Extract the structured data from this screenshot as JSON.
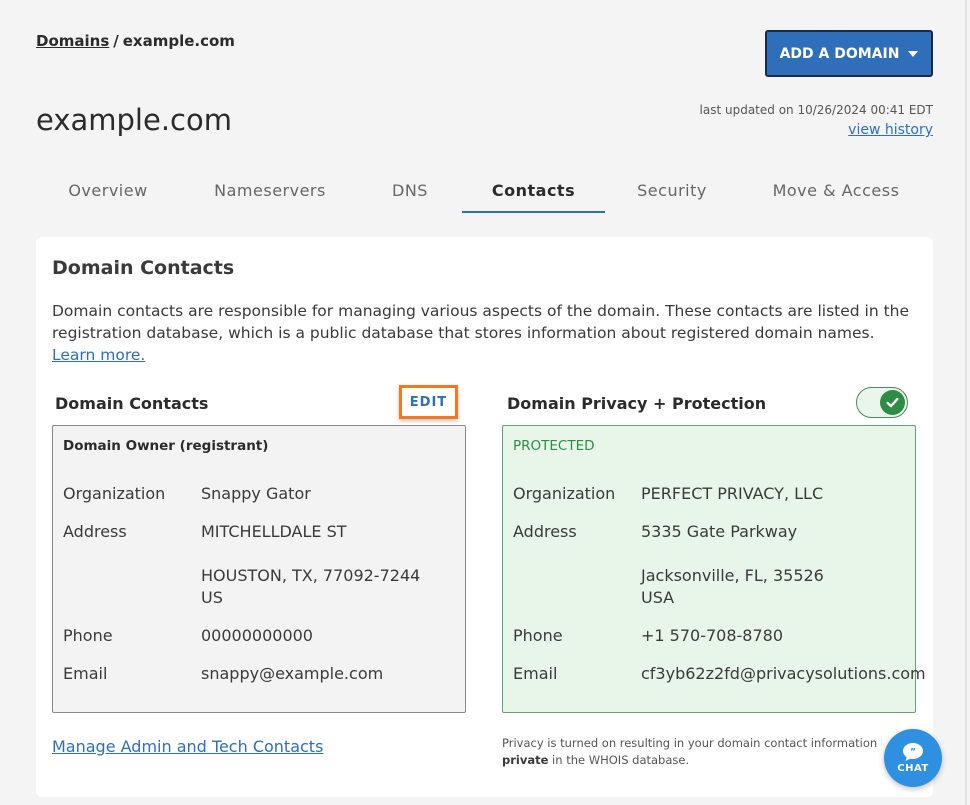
{
  "breadcrumb": {
    "root": "Domains",
    "separator": "/",
    "current": "example.com"
  },
  "header": {
    "add_domain_label": "ADD A DOMAIN",
    "title": "example.com",
    "last_updated": "last updated on 10/26/2024 00:41 EDT",
    "view_history": "view history"
  },
  "tabs": [
    {
      "label": "Overview",
      "active": false
    },
    {
      "label": "Nameservers",
      "active": false
    },
    {
      "label": "DNS",
      "active": false
    },
    {
      "label": "Contacts",
      "active": true
    },
    {
      "label": "Security",
      "active": false
    },
    {
      "label": "Move & Access",
      "active": false
    }
  ],
  "card": {
    "title": "Domain Contacts",
    "description": "Domain contacts are responsible for managing various aspects of the domain. These contacts are listed in the registration database, which is a public database that stores information about registered domain names.",
    "learn_more": "Learn more."
  },
  "owner": {
    "heading": "Domain Contacts",
    "edit_label": "EDIT",
    "box_title": "Domain Owner (registrant)",
    "organization_label": "Organization",
    "organization": "Snappy Gator",
    "address_label": "Address",
    "address_line1": "MITCHELLDALE ST",
    "address_line2": "HOUSTON, TX, 77092-7244",
    "address_line3": "US",
    "phone_label": "Phone",
    "phone": "00000000000",
    "email_label": "Email",
    "email": "snappy@example.com"
  },
  "privacy": {
    "heading": "Domain Privacy + Protection",
    "toggle_on": true,
    "status": "PROTECTED",
    "organization_label": "Organization",
    "organization": "PERFECT PRIVACY, LLC",
    "address_label": "Address",
    "address_line1": "5335 Gate Parkway",
    "address_line2": "Jacksonville, FL, 35526",
    "address_line3": "USA",
    "phone_label": "Phone",
    "phone": "+1 570-708-8780",
    "email_label": "Email",
    "email": "cf3yb62z2fd@privacysolutions.com",
    "note_prefix": "Privacy is turned on resulting in your domain contact information bei",
    "note_bold": "private",
    "note_suffix": " in the WHOIS database."
  },
  "manage_link": "Manage Admin and Tech Contacts",
  "chat": {
    "label": "CHAT"
  },
  "colors": {
    "accent": "#2f6fba",
    "edit_highlight": "#f07a22",
    "protected_green": "#2e8c45",
    "chat_blue": "#2f8fe0"
  }
}
